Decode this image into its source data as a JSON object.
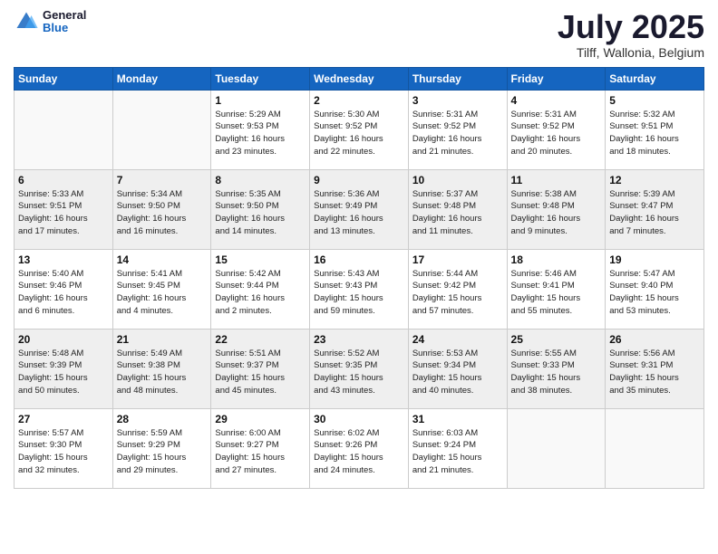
{
  "header": {
    "logo_line1": "General",
    "logo_line2": "Blue",
    "title": "July 2025",
    "subtitle": "Tilff, Wallonia, Belgium"
  },
  "days_of_week": [
    "Sunday",
    "Monday",
    "Tuesday",
    "Wednesday",
    "Thursday",
    "Friday",
    "Saturday"
  ],
  "weeks": [
    [
      {
        "day": "",
        "info": ""
      },
      {
        "day": "",
        "info": ""
      },
      {
        "day": "1",
        "info": "Sunrise: 5:29 AM\nSunset: 9:53 PM\nDaylight: 16 hours\nand 23 minutes."
      },
      {
        "day": "2",
        "info": "Sunrise: 5:30 AM\nSunset: 9:52 PM\nDaylight: 16 hours\nand 22 minutes."
      },
      {
        "day": "3",
        "info": "Sunrise: 5:31 AM\nSunset: 9:52 PM\nDaylight: 16 hours\nand 21 minutes."
      },
      {
        "day": "4",
        "info": "Sunrise: 5:31 AM\nSunset: 9:52 PM\nDaylight: 16 hours\nand 20 minutes."
      },
      {
        "day": "5",
        "info": "Sunrise: 5:32 AM\nSunset: 9:51 PM\nDaylight: 16 hours\nand 18 minutes."
      }
    ],
    [
      {
        "day": "6",
        "info": "Sunrise: 5:33 AM\nSunset: 9:51 PM\nDaylight: 16 hours\nand 17 minutes."
      },
      {
        "day": "7",
        "info": "Sunrise: 5:34 AM\nSunset: 9:50 PM\nDaylight: 16 hours\nand 16 minutes."
      },
      {
        "day": "8",
        "info": "Sunrise: 5:35 AM\nSunset: 9:50 PM\nDaylight: 16 hours\nand 14 minutes."
      },
      {
        "day": "9",
        "info": "Sunrise: 5:36 AM\nSunset: 9:49 PM\nDaylight: 16 hours\nand 13 minutes."
      },
      {
        "day": "10",
        "info": "Sunrise: 5:37 AM\nSunset: 9:48 PM\nDaylight: 16 hours\nand 11 minutes."
      },
      {
        "day": "11",
        "info": "Sunrise: 5:38 AM\nSunset: 9:48 PM\nDaylight: 16 hours\nand 9 minutes."
      },
      {
        "day": "12",
        "info": "Sunrise: 5:39 AM\nSunset: 9:47 PM\nDaylight: 16 hours\nand 7 minutes."
      }
    ],
    [
      {
        "day": "13",
        "info": "Sunrise: 5:40 AM\nSunset: 9:46 PM\nDaylight: 16 hours\nand 6 minutes."
      },
      {
        "day": "14",
        "info": "Sunrise: 5:41 AM\nSunset: 9:45 PM\nDaylight: 16 hours\nand 4 minutes."
      },
      {
        "day": "15",
        "info": "Sunrise: 5:42 AM\nSunset: 9:44 PM\nDaylight: 16 hours\nand 2 minutes."
      },
      {
        "day": "16",
        "info": "Sunrise: 5:43 AM\nSunset: 9:43 PM\nDaylight: 15 hours\nand 59 minutes."
      },
      {
        "day": "17",
        "info": "Sunrise: 5:44 AM\nSunset: 9:42 PM\nDaylight: 15 hours\nand 57 minutes."
      },
      {
        "day": "18",
        "info": "Sunrise: 5:46 AM\nSunset: 9:41 PM\nDaylight: 15 hours\nand 55 minutes."
      },
      {
        "day": "19",
        "info": "Sunrise: 5:47 AM\nSunset: 9:40 PM\nDaylight: 15 hours\nand 53 minutes."
      }
    ],
    [
      {
        "day": "20",
        "info": "Sunrise: 5:48 AM\nSunset: 9:39 PM\nDaylight: 15 hours\nand 50 minutes."
      },
      {
        "day": "21",
        "info": "Sunrise: 5:49 AM\nSunset: 9:38 PM\nDaylight: 15 hours\nand 48 minutes."
      },
      {
        "day": "22",
        "info": "Sunrise: 5:51 AM\nSunset: 9:37 PM\nDaylight: 15 hours\nand 45 minutes."
      },
      {
        "day": "23",
        "info": "Sunrise: 5:52 AM\nSunset: 9:35 PM\nDaylight: 15 hours\nand 43 minutes."
      },
      {
        "day": "24",
        "info": "Sunrise: 5:53 AM\nSunset: 9:34 PM\nDaylight: 15 hours\nand 40 minutes."
      },
      {
        "day": "25",
        "info": "Sunrise: 5:55 AM\nSunset: 9:33 PM\nDaylight: 15 hours\nand 38 minutes."
      },
      {
        "day": "26",
        "info": "Sunrise: 5:56 AM\nSunset: 9:31 PM\nDaylight: 15 hours\nand 35 minutes."
      }
    ],
    [
      {
        "day": "27",
        "info": "Sunrise: 5:57 AM\nSunset: 9:30 PM\nDaylight: 15 hours\nand 32 minutes."
      },
      {
        "day": "28",
        "info": "Sunrise: 5:59 AM\nSunset: 9:29 PM\nDaylight: 15 hours\nand 29 minutes."
      },
      {
        "day": "29",
        "info": "Sunrise: 6:00 AM\nSunset: 9:27 PM\nDaylight: 15 hours\nand 27 minutes."
      },
      {
        "day": "30",
        "info": "Sunrise: 6:02 AM\nSunset: 9:26 PM\nDaylight: 15 hours\nand 24 minutes."
      },
      {
        "day": "31",
        "info": "Sunrise: 6:03 AM\nSunset: 9:24 PM\nDaylight: 15 hours\nand 21 minutes."
      },
      {
        "day": "",
        "info": ""
      },
      {
        "day": "",
        "info": ""
      }
    ]
  ]
}
